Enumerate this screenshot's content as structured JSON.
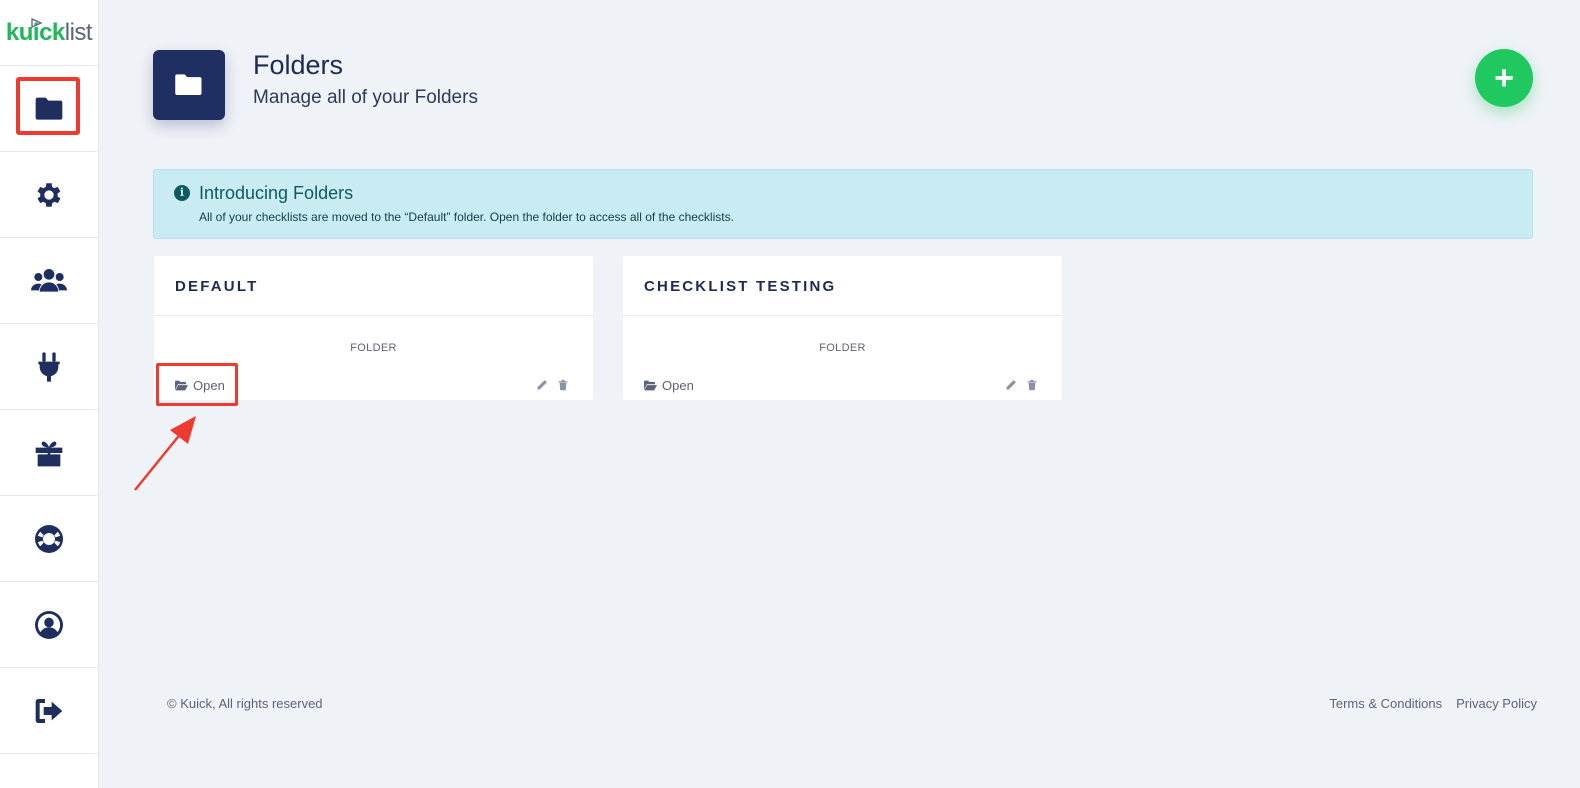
{
  "app": {
    "logo_brand": "kuick",
    "logo_suffix": "list",
    "brand_color": "#20b65a",
    "accent_color": "#1f2f62"
  },
  "sidebar": {
    "items": [
      {
        "name": "folders",
        "icon": "folder-icon",
        "active": true
      },
      {
        "name": "settings",
        "icon": "gear-icon"
      },
      {
        "name": "team",
        "icon": "users-icon"
      },
      {
        "name": "integrations",
        "icon": "plug-icon"
      },
      {
        "name": "rewards",
        "icon": "gift-icon"
      },
      {
        "name": "support",
        "icon": "lifebuoy-icon"
      },
      {
        "name": "profile",
        "icon": "user-circle-icon"
      },
      {
        "name": "logout",
        "icon": "sign-out-icon"
      }
    ]
  },
  "header": {
    "title": "Folders",
    "subtitle": "Manage all of your Folders",
    "add_button": "+"
  },
  "alert": {
    "title": "Introducing Folders",
    "text": "All of your checklists are moved to the “Default” folder. Open the folder to access all of the checklists."
  },
  "folders": [
    {
      "title": "DEFAULT",
      "type": "FOLDER",
      "open_label": "Open"
    },
    {
      "title": "CHECKLIST TESTING",
      "type": "FOLDER",
      "open_label": "Open"
    }
  ],
  "footer": {
    "copyright": "© Kuick, All rights reserved",
    "terms": "Terms & Conditions",
    "privacy": "Privacy Policy"
  }
}
